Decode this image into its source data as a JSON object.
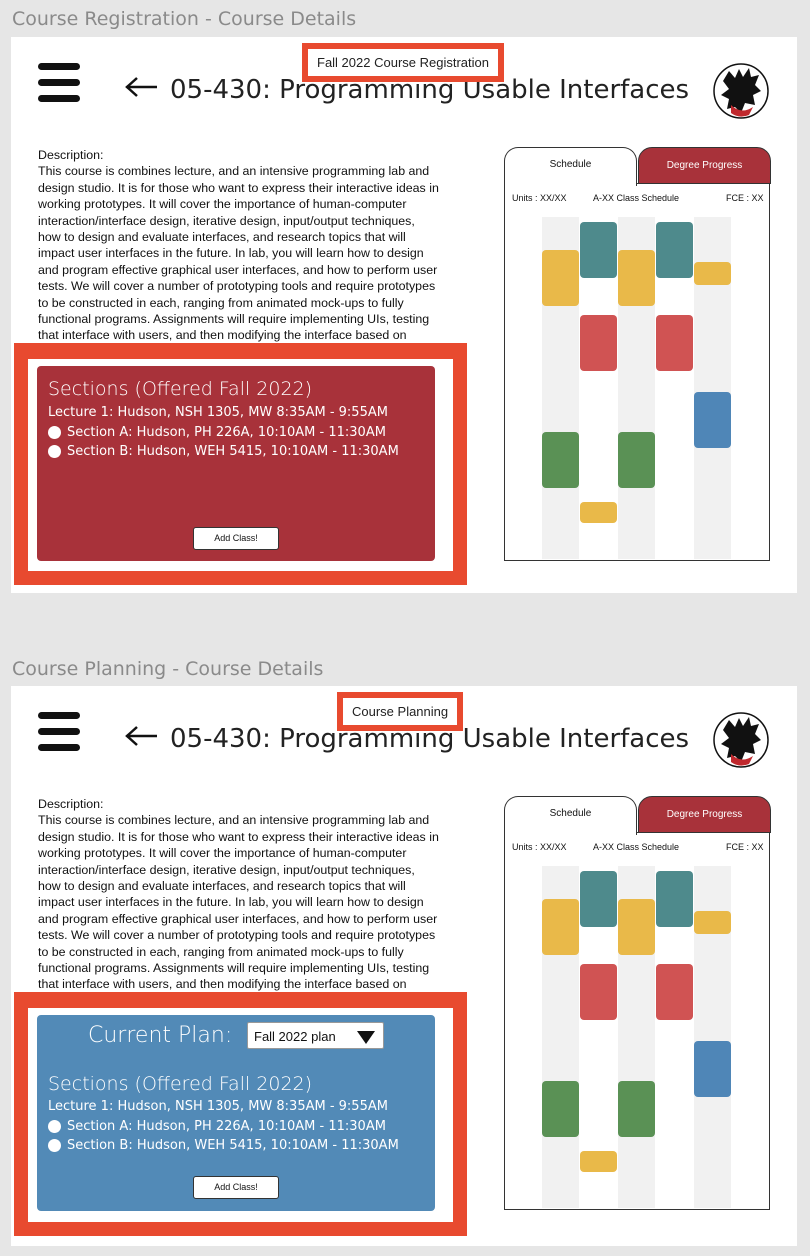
{
  "registration": {
    "frame_title": "Course Registration - Course Details",
    "callout": "Fall 2022 Course Registration",
    "course_title": "05-430: Programming Usable Interfaces",
    "description_label": "Description:",
    "description": "This course is combines lecture, and an intensive programming lab and design studio. It is for those who want to express their interactive ideas in working prototypes. It will cover the importance of human-computer interaction/interface design, iterative design, input/output techniques, how to design and evaluate interfaces, and research topics that will impact user interfaces in the future. In lab, you will learn how to design and program effective graphical user interfaces, and how to perform user tests. We will cover a number of prototyping tools and require prototypes to be constructed in each, ranging from animated mock-ups to fully functional programs. Assignments will require implementing UIs, testing that interface with users, and then modifying the interface based on",
    "sections_title": "Sections (Offered Fall 2022)",
    "lecture": "Lecture 1: Hudson, NSH 1305, MW 8:35AM - 9:55AM",
    "section_a": "Section A: Hudson, PH 226A, 10:10AM - 11:30AM",
    "section_b": "Section B: Hudson, WEH 5415, 10:10AM - 11:30AM",
    "add_button": "Add Class!",
    "panel_color": "#a8323a"
  },
  "planning": {
    "frame_title": "Course Planning - Course Details",
    "callout": "Course Planning",
    "course_title": "05-430: Programming Usable Interfaces",
    "description_label": "Description:",
    "description": "This course is combines lecture, and an intensive programming lab and design studio. It is for those who want to express their interactive ideas in working prototypes. It will cover the importance of human-computer interaction/interface design, iterative design, input/output techniques, how to design and evaluate interfaces, and research topics that will impact user interfaces in the future. In lab, you will learn how to design and program effective graphical user interfaces, and how to perform user tests. We will cover a number of prototyping tools and require prototypes to be constructed in each, ranging from animated mock-ups to fully functional programs. Assignments will require implementing UIs, testing that interface with users, and then modifying the interface based on",
    "plan_label": "Current Plan:",
    "plan_value": "Fall 2022 plan",
    "sections_title": "Sections (Offered Fall 2022)",
    "lecture": "Lecture 1: Hudson, NSH 1305, MW 8:35AM - 9:55AM",
    "section_a": "Section A: Hudson, PH 226A, 10:10AM - 11:30AM",
    "section_b": "Section B: Hudson, WEH 5415, 10:10AM - 11:30AM",
    "add_button": "Add Class!",
    "panel_color": "#528ab7"
  },
  "schedule": {
    "tab_schedule": "Schedule",
    "tab_degree": "Degree Progress",
    "units": "Units : XX/XX",
    "class_schedule": "A-XX Class Schedule",
    "fce": "FCE : XX"
  },
  "colors": {
    "accent_red": "#a8323a",
    "callout_border": "#e84a2f",
    "block_yellow": "#e9b949",
    "block_teal": "#4e8a8c",
    "block_red": "#d05353",
    "block_blue": "#4f86b7",
    "block_green": "#5a9155"
  }
}
